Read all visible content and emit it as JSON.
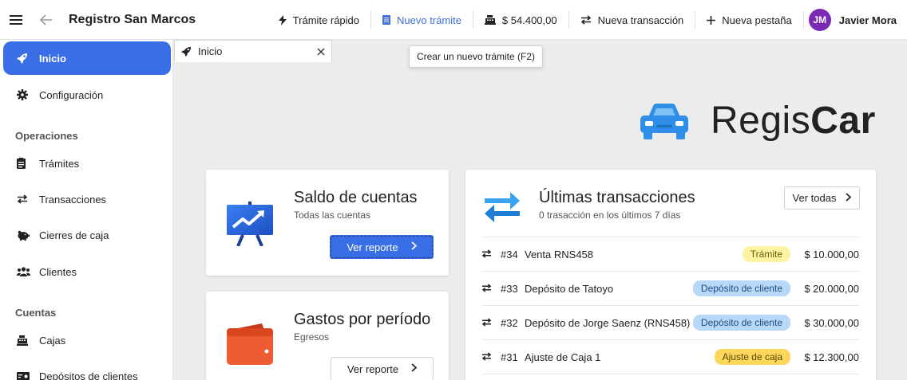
{
  "header": {
    "title": "Registro San Marcos",
    "actions": [
      {
        "label": "Trámite rápido",
        "icon": "bolt-icon"
      },
      {
        "label": "Nuevo trámite",
        "icon": "document-icon"
      },
      {
        "label": "$ 54.400,00",
        "icon": "cash-register-icon"
      },
      {
        "label": "Nueva transacción",
        "icon": "transfer-icon"
      },
      {
        "label": "Nueva pestaña",
        "icon": "plus-icon"
      }
    ],
    "user": {
      "initials": "JM",
      "name": "Javier Mora"
    },
    "colors": {
      "accent": "#3a6ee6",
      "avatar": "#7a2bb5"
    }
  },
  "tooltip": "Crear un nuevo trámite (F2)",
  "sidebar": {
    "top_items": [
      {
        "label": "Inicio",
        "icon": "rocket-icon"
      },
      {
        "label": "Configuración",
        "icon": "gear-icon"
      }
    ],
    "sections": [
      {
        "title": "Operaciones",
        "items": [
          {
            "label": "Trámites",
            "icon": "clipboard-icon"
          },
          {
            "label": "Transacciones",
            "icon": "transfer-icon"
          },
          {
            "label": "Cierres de caja",
            "icon": "piggy-bank-icon"
          },
          {
            "label": "Clientes",
            "icon": "users-icon"
          }
        ]
      },
      {
        "title": "Cuentas",
        "items": [
          {
            "label": "Cajas",
            "icon": "cash-register-icon"
          },
          {
            "label": "Depósitos de clientes",
            "icon": "money-bill-icon"
          }
        ]
      }
    ]
  },
  "tab": {
    "label": "Inicio",
    "icon": "rocket-icon"
  },
  "logo": {
    "regular": "Regis",
    "bold": "Car"
  },
  "balance_card": {
    "title": "Saldo de cuentas",
    "subtitle": "Todas las cuentas",
    "button": "Ver reporte"
  },
  "expenses_card": {
    "title": "Gastos por período",
    "subtitle": "Egresos",
    "button": "Ver reporte"
  },
  "transactions_card": {
    "title": "Últimas transacciones",
    "subtitle": "0 trasacción en los últimos 7 días",
    "button": "Ver todas",
    "rows": [
      {
        "num": "#34",
        "desc": "Venta RNS458",
        "badge": "Trámite",
        "badge_bg": "#fdf3a3",
        "badge_fg": "#6b5a00",
        "amount": "$ 10.000,00"
      },
      {
        "num": "#33",
        "desc": "Depósito de Tatoyo",
        "badge": "Depósito de cliente",
        "badge_bg": "#b7d9f7",
        "badge_fg": "#1b4e85",
        "amount": "$ 20.000,00"
      },
      {
        "num": "#32",
        "desc": "Depósito de Jorge Saenz (RNS458)",
        "badge": "Depósito de cliente",
        "badge_bg": "#b7d9f7",
        "badge_fg": "#1b4e85",
        "amount": "$ 30.000,00"
      },
      {
        "num": "#31",
        "desc": "Ajuste de Caja 1",
        "badge": "Ajuste de caja",
        "badge_bg": "#fcd75b",
        "badge_fg": "#5a4300",
        "amount": "$ 12.300,00"
      }
    ]
  }
}
